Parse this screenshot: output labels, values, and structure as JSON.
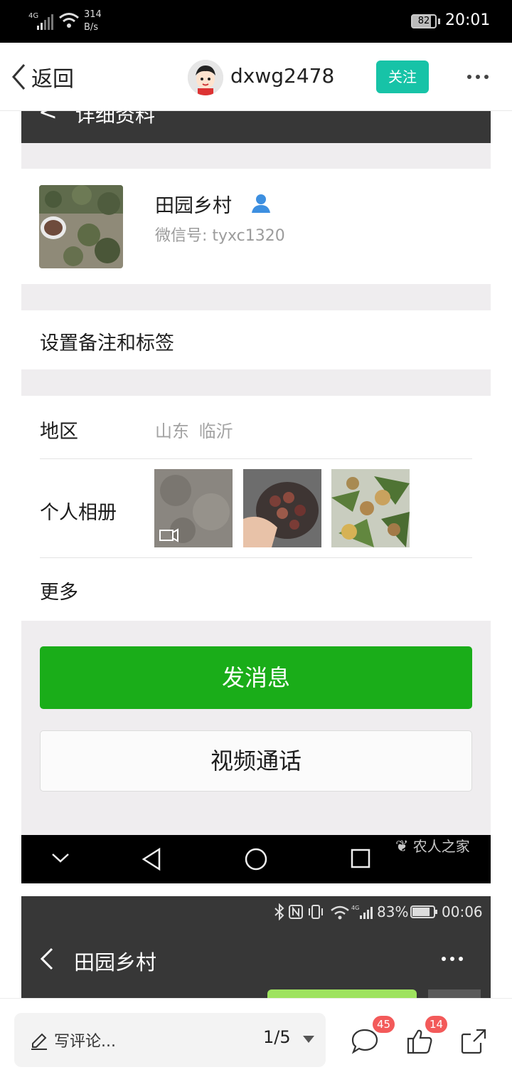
{
  "status_bar": {
    "network_label": "4G",
    "speed_value": "314",
    "speed_unit": "B/s",
    "battery_level": "82",
    "time": "20:01"
  },
  "app_header": {
    "back_label": "返回",
    "username": "dxwg2478",
    "follow_label": "关注",
    "more_icon": "more-dots-icon"
  },
  "screenshot_1": {
    "topbar_title": "详细资料",
    "profile": {
      "name": "田园乡村",
      "wechat_id": "微信号: tyxc1320"
    },
    "remark_label": "设置备注和标签",
    "region_label": "地区",
    "region_value": "山东  临沂",
    "album_label": "个人相册",
    "more_label": "更多",
    "send_message_label": "发消息",
    "video_call_label": "视频通话",
    "watermark": "农人之家"
  },
  "screenshot_2": {
    "status_battery": "83%",
    "status_time": "00:06",
    "title": "田园乡村"
  },
  "bottom_bar": {
    "comment_placeholder": "写评论...",
    "page_indicator": "1/5",
    "comment_count": "45",
    "like_count": "14"
  },
  "colors": {
    "follow_button": "#17c3a7",
    "send_button": "#1aad19",
    "badge": "#f35a5a",
    "dark_bar": "#373737"
  }
}
